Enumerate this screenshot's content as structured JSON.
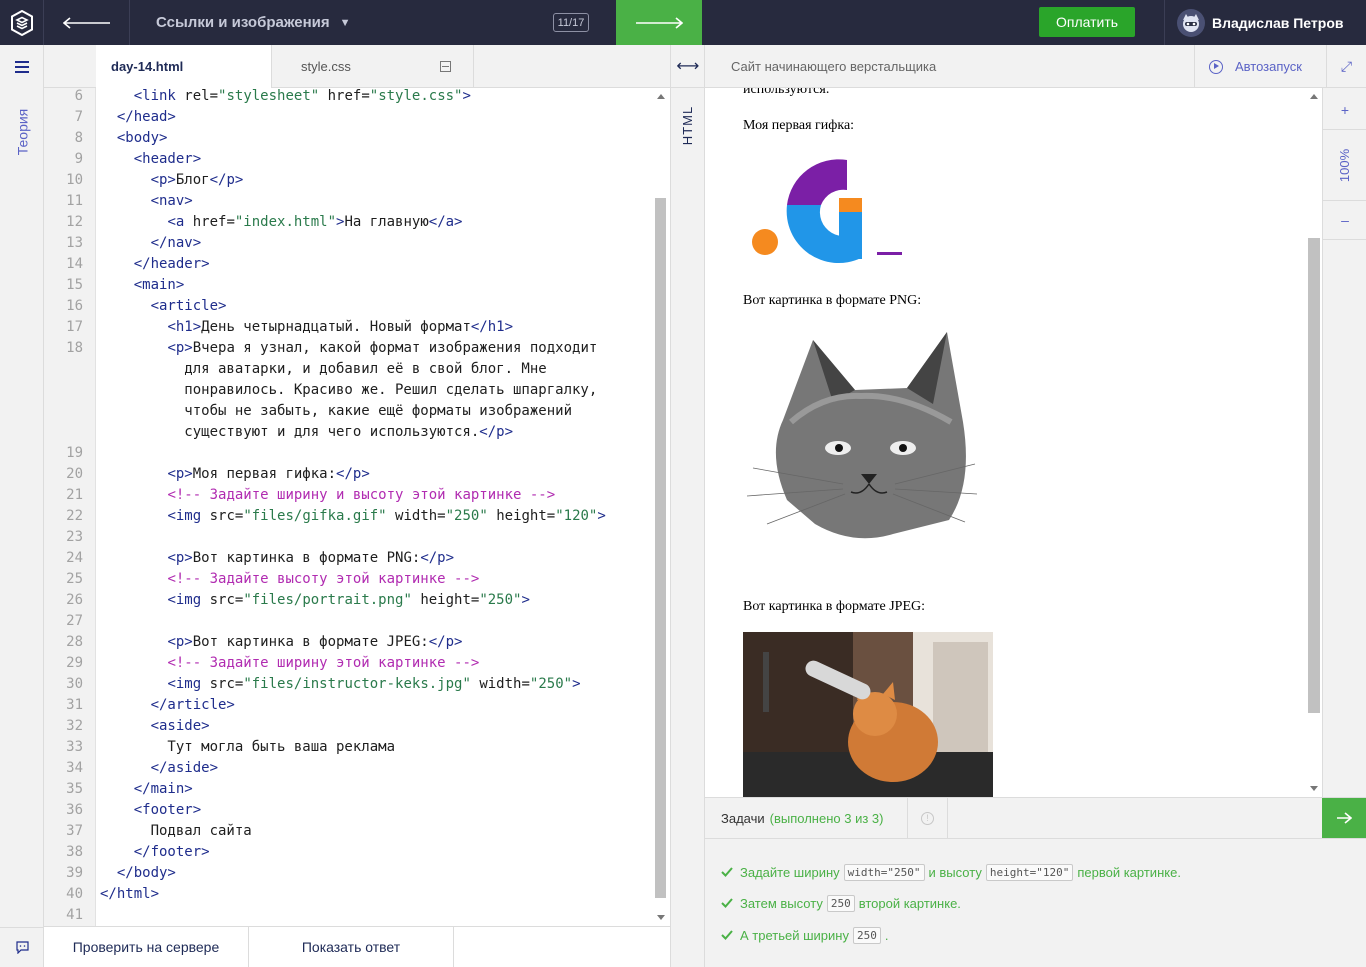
{
  "topbar": {
    "title": "Ссылки и изображения",
    "progress": "11/17",
    "pay_label": "Оплатить",
    "user_name": "Владислав Петров",
    "accent_green": "#4ab146",
    "bg": "#272a3e"
  },
  "sidebar": {
    "theory_label": "Теория"
  },
  "editor": {
    "tabs": [
      {
        "label": "day-14.html",
        "active": true
      },
      {
        "label": "style.css",
        "active": false
      }
    ],
    "line_numbers": [
      "6",
      "7",
      "8",
      "9",
      "10",
      "11",
      "12",
      "13",
      "14",
      "15",
      "16",
      "17",
      "18",
      "",
      "",
      "",
      "",
      "19",
      "20",
      "21",
      "22",
      "23",
      "24",
      "25",
      "26",
      "27",
      "28",
      "29",
      "30",
      "31",
      "32",
      "33",
      "34",
      "35",
      "36",
      "37",
      "38",
      "39",
      "40",
      "41"
    ],
    "check_button": "Проверить на сервере",
    "answer_button": "Показать ответ"
  },
  "divider": {
    "mode_label": "HTML"
  },
  "preview": {
    "title": "Сайт начинающего верстальщика",
    "autorun_label": "Автозапуск",
    "zoom": "100%",
    "zoom_in": "+",
    "zoom_out": "–",
    "cut_text": "используются.",
    "gif_caption": "Моя первая гифка:",
    "png_caption": "Вот картинка в формате PNG:",
    "jpeg_caption": "Вот картинка в формате JPEG:"
  },
  "tasks": {
    "label": "Задачи",
    "done": "(выполнено 3 из 3)",
    "items": [
      {
        "parts": [
          "Задайте ширину",
          "width=\"250\"",
          "и высоту",
          "height=\"120\"",
          "первой картинке."
        ]
      },
      {
        "parts": [
          "Затем высоту",
          "250",
          "второй картинке."
        ]
      },
      {
        "parts": [
          "А третьей ширину",
          "250",
          "."
        ]
      }
    ]
  }
}
